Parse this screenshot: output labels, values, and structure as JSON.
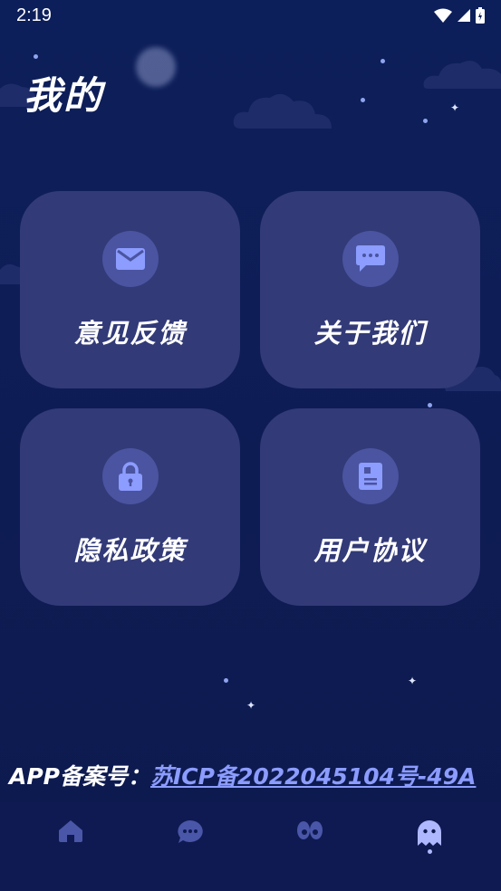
{
  "status_bar": {
    "time": "2:19"
  },
  "page": {
    "title": "我的"
  },
  "menu": [
    {
      "label": "意见反馈",
      "icon": "mail-icon"
    },
    {
      "label": "关于我们",
      "icon": "chat-bubble-icon"
    },
    {
      "label": "隐私政策",
      "icon": "lock-icon"
    },
    {
      "label": "用户协议",
      "icon": "document-icon"
    }
  ],
  "footer": {
    "icp_label": "APP备案号：",
    "icp_number": "苏ICP备2022045104号-49A"
  },
  "tab_bar": {
    "tabs": [
      {
        "icon": "home-icon",
        "active": false
      },
      {
        "icon": "chat-icon",
        "active": false
      },
      {
        "icon": "eyes-icon",
        "active": false
      },
      {
        "icon": "ghost-icon",
        "active": true
      }
    ]
  },
  "colors": {
    "background": "#0d1f5a",
    "card": "#323a78",
    "icon_circle": "#4a54a0",
    "icon": "#8c9cff",
    "link": "#8c9cff"
  }
}
